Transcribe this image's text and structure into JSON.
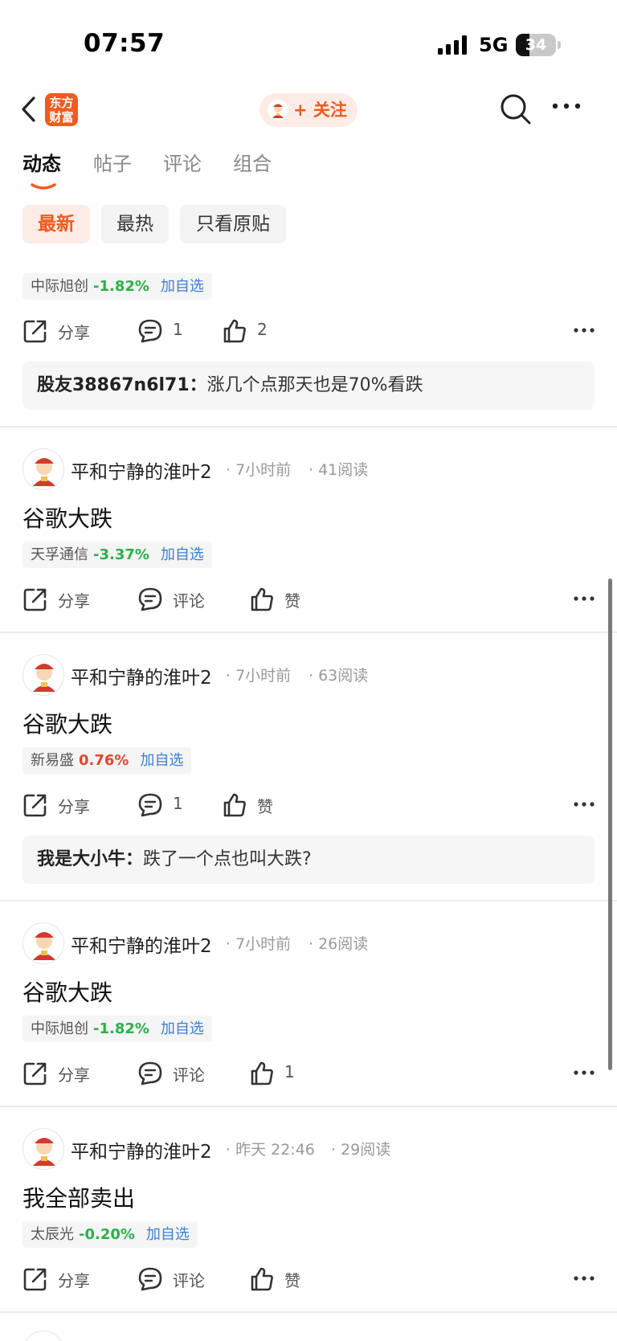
{
  "status_bar": {
    "time": "07:57",
    "network": "5G",
    "battery": "34",
    "battery_level": 0.34
  },
  "nav": {
    "logo_line1": "东方",
    "logo_line2": "财富",
    "follow_label": "+ 关注"
  },
  "tabs": [
    {
      "label": "动态",
      "active": true
    },
    {
      "label": "帖子",
      "active": false
    },
    {
      "label": "评论",
      "active": false
    },
    {
      "label": "组合",
      "active": false
    }
  ],
  "filters": [
    {
      "label": "最新",
      "active": true
    },
    {
      "label": "最热",
      "active": false
    },
    {
      "label": "只看原贴",
      "active": false
    }
  ],
  "colors": {
    "brand": "#f25a1e",
    "stock_down": "#2bb04a",
    "stock_up": "#e5442b",
    "link": "#3b7fd6"
  },
  "posts": [
    {
      "stock": {
        "name": "中际旭创",
        "change": "-1.82%",
        "direction": "down",
        "add_label": "加自选"
      },
      "actions": {
        "share": "分享",
        "comment": "1",
        "like": "2"
      },
      "top_comment": {
        "user": "股友38867n6l71：",
        "text": "涨几个点那天也是70%看跌"
      }
    },
    {
      "author": "平和宁静的淮叶2",
      "time": "7小时前",
      "reads": "41阅读",
      "text": "谷歌大跌",
      "stock": {
        "name": "天孚通信",
        "change": "-3.37%",
        "direction": "down",
        "add_label": "加自选"
      },
      "actions": {
        "share": "分享",
        "comment": "评论",
        "like": "赞"
      }
    },
    {
      "author": "平和宁静的淮叶2",
      "time": "7小时前",
      "reads": "63阅读",
      "text": "谷歌大跌",
      "stock": {
        "name": "新易盛",
        "change": "0.76%",
        "direction": "up",
        "add_label": "加自选"
      },
      "actions": {
        "share": "分享",
        "comment": "1",
        "like": "赞"
      },
      "top_comment": {
        "user": "我是大小牛：",
        "text": "跌了一个点也叫大跌?"
      }
    },
    {
      "author": "平和宁静的淮叶2",
      "time": "7小时前",
      "reads": "26阅读",
      "text": "谷歌大跌",
      "stock": {
        "name": "中际旭创",
        "change": "-1.82%",
        "direction": "down",
        "add_label": "加自选"
      },
      "actions": {
        "share": "分享",
        "comment": "评论",
        "like": "1"
      }
    },
    {
      "author": "平和宁静的淮叶2",
      "time": "昨天 22:46",
      "reads": "29阅读",
      "text": "我全部卖出",
      "stock": {
        "name": "太辰光",
        "change": "-0.20%",
        "direction": "down",
        "add_label": "加自选"
      },
      "actions": {
        "share": "分享",
        "comment": "评论",
        "like": "赞"
      }
    }
  ]
}
